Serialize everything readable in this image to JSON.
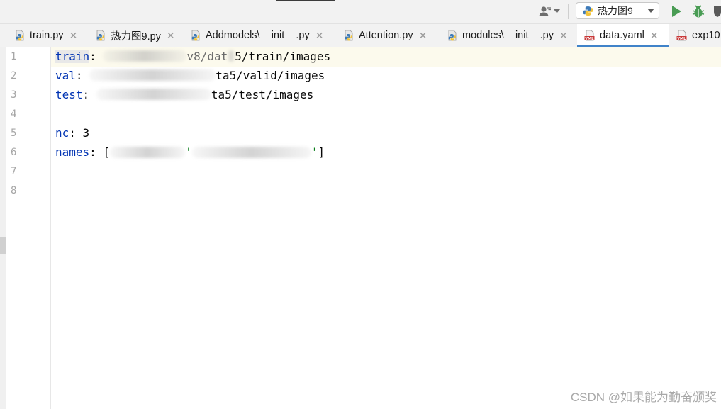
{
  "toolbar": {
    "run_config_label": "热力图9"
  },
  "tabs": [
    {
      "label": "train.py",
      "type": "py"
    },
    {
      "label": "热力图9.py",
      "type": "py"
    },
    {
      "label": "Addmodels\\__init__.py",
      "type": "py"
    },
    {
      "label": "Attention.py",
      "type": "py"
    },
    {
      "label": "modules\\__init__.py",
      "type": "py"
    },
    {
      "label": "data.yaml",
      "type": "yaml",
      "active": true
    },
    {
      "label": "exp10",
      "type": "yaml"
    }
  ],
  "editor": {
    "line_numbers": [
      "1",
      "2",
      "3",
      "4",
      "5",
      "6",
      "7",
      "8"
    ],
    "lines": {
      "l1_key": "train",
      "l1_colon": ":",
      "l1_value_tail": "/train/images",
      "l1_value_mid": "v8/dat",
      "l1_value_mid2": "5",
      "l2_key": "val",
      "l2_colon": ":",
      "l2_value_tail": "ta5/valid/images",
      "l3_key": "test",
      "l3_colon": ":",
      "l3_value_tail": "ta5/test/images",
      "l5_key": "nc",
      "l5_colon": ":",
      "l5_value": "3",
      "l6_key": "names",
      "l6_colon": ":",
      "l6_open": "[",
      "l6_close": "]",
      "l6_frag1": "'",
      "l6_frag2": "'"
    }
  },
  "watermark": "CSDN @如果能为勤奋颁奖"
}
